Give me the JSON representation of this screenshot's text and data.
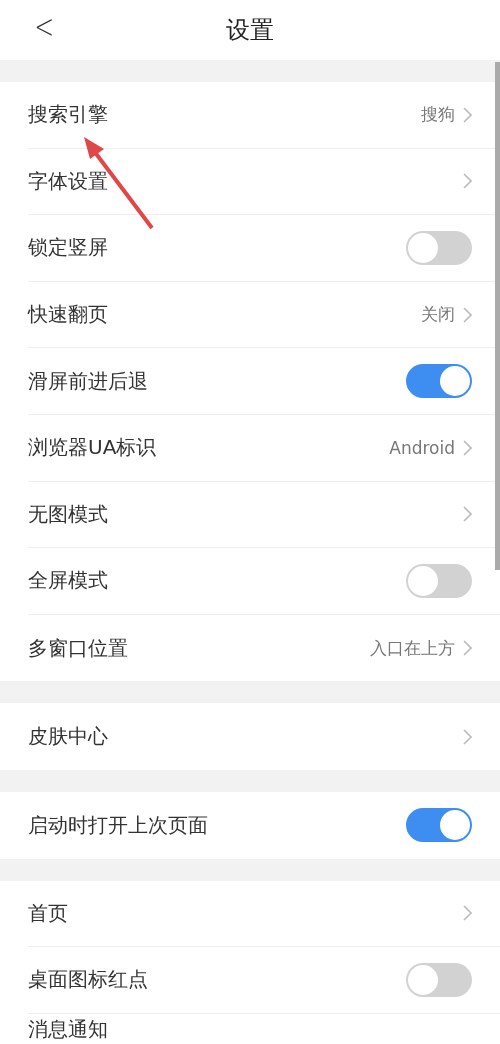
{
  "header": {
    "back": "<",
    "title": "设置"
  },
  "groups": [
    {
      "items": [
        {
          "kind": "link",
          "label": "搜索引擎",
          "value": "搜狗"
        },
        {
          "kind": "link",
          "label": "字体设置"
        },
        {
          "kind": "toggle",
          "label": "锁定竖屏",
          "on": false
        },
        {
          "kind": "link",
          "label": "快速翻页",
          "value": "关闭"
        },
        {
          "kind": "toggle",
          "label": "滑屏前进后退",
          "on": true
        },
        {
          "kind": "link",
          "label": "浏览器UA标识",
          "value": "Android"
        },
        {
          "kind": "link",
          "label": "无图模式"
        },
        {
          "kind": "toggle",
          "label": "全屏模式",
          "on": false
        },
        {
          "kind": "link",
          "label": "多窗口位置",
          "value": "入口在上方"
        }
      ]
    },
    {
      "items": [
        {
          "kind": "link",
          "label": "皮肤中心"
        }
      ]
    },
    {
      "items": [
        {
          "kind": "toggle",
          "label": "启动时打开上次页面",
          "on": true
        }
      ]
    },
    {
      "items": [
        {
          "kind": "link",
          "label": "首页"
        },
        {
          "kind": "toggle",
          "label": "桌面图标红点",
          "on": false
        },
        {
          "kind": "cut",
          "label": "消息通知"
        }
      ]
    }
  ]
}
